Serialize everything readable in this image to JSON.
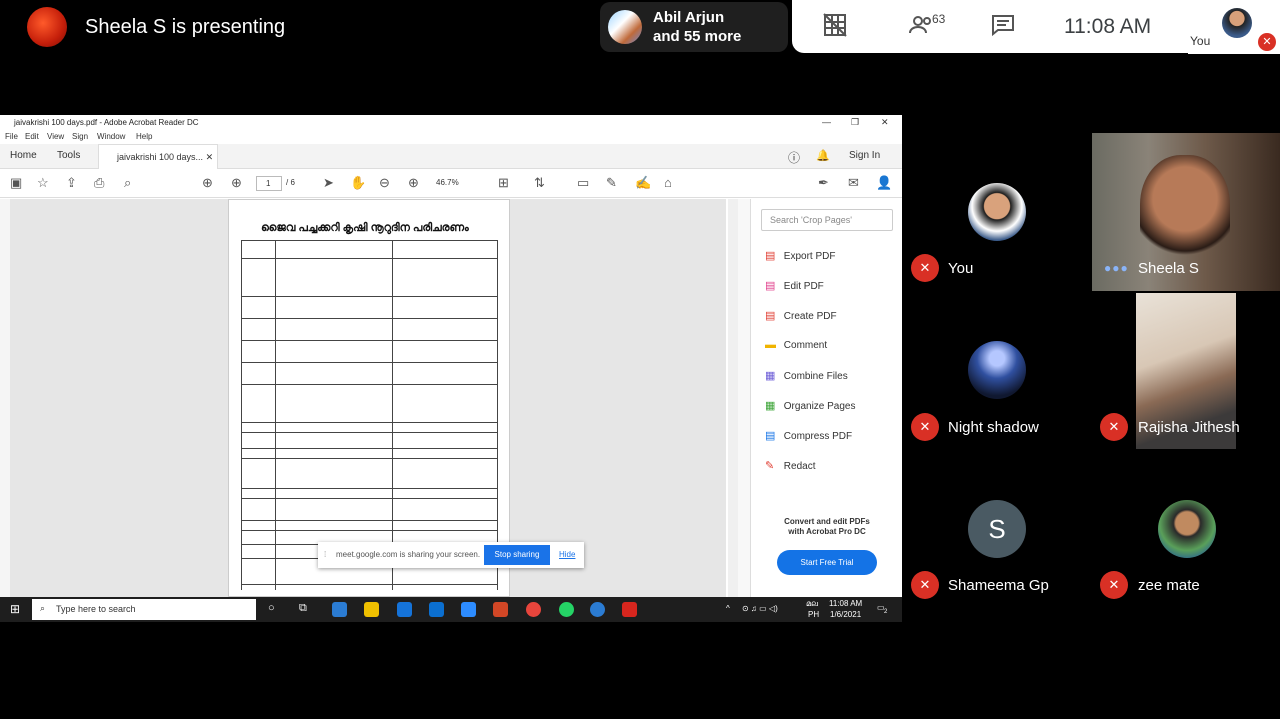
{
  "presenting": {
    "text": "Sheela S is presenting"
  },
  "pill": {
    "line1": "Abil Arjun",
    "line2": "and 55 more"
  },
  "meetbar": {
    "participants_count": "63",
    "time": "11:08  AM",
    "you_label": "You"
  },
  "acrobat": {
    "title": "jaivakrishi 100 days.pdf - Adobe Acrobat Reader DC",
    "menu": [
      "File",
      "Edit",
      "View",
      "Sign",
      "Window",
      "Help"
    ],
    "tabs": {
      "home": "Home",
      "tools": "Tools",
      "doc": "jaivakrishi 100 days...",
      "signin": "Sign In"
    },
    "page_current": "1",
    "page_total": "/ 6",
    "zoom": "46.7%",
    "pdf_title": "ജൈവ പച്ചക്കറി കൃഷി നൂറുദിന പരിചരണം",
    "search_placeholder": "Search 'Crop Pages'",
    "tools": [
      "Export PDF",
      "Edit PDF",
      "Create PDF",
      "Comment",
      "Combine Files",
      "Organize Pages",
      "Compress PDF",
      "Redact"
    ],
    "promo_line1": "Convert and edit PDFs",
    "promo_line2": "with Acrobat Pro DC",
    "trial_button": "Start Free Trial"
  },
  "sharebar": {
    "message": "meet.google.com is sharing your screen.",
    "stop": "Stop sharing",
    "hide": "Hide"
  },
  "taskbar": {
    "search": "Type here to search",
    "time": "11:08 AM",
    "date": "1/6/2021",
    "lang1": "മല",
    "lang2": "PH",
    "notif": "2"
  },
  "participants": [
    {
      "name": "You"
    },
    {
      "name": "Sheela S"
    },
    {
      "name": "Night shadow"
    },
    {
      "name": "Rajisha Jithesh"
    },
    {
      "name": "Shameema Gp",
      "initial": "S"
    },
    {
      "name": "zee mate"
    }
  ],
  "colors": {
    "mute_red": "#d93025",
    "meet_blue": "#1a73e8",
    "acrobat_blue": "#1473e6"
  }
}
